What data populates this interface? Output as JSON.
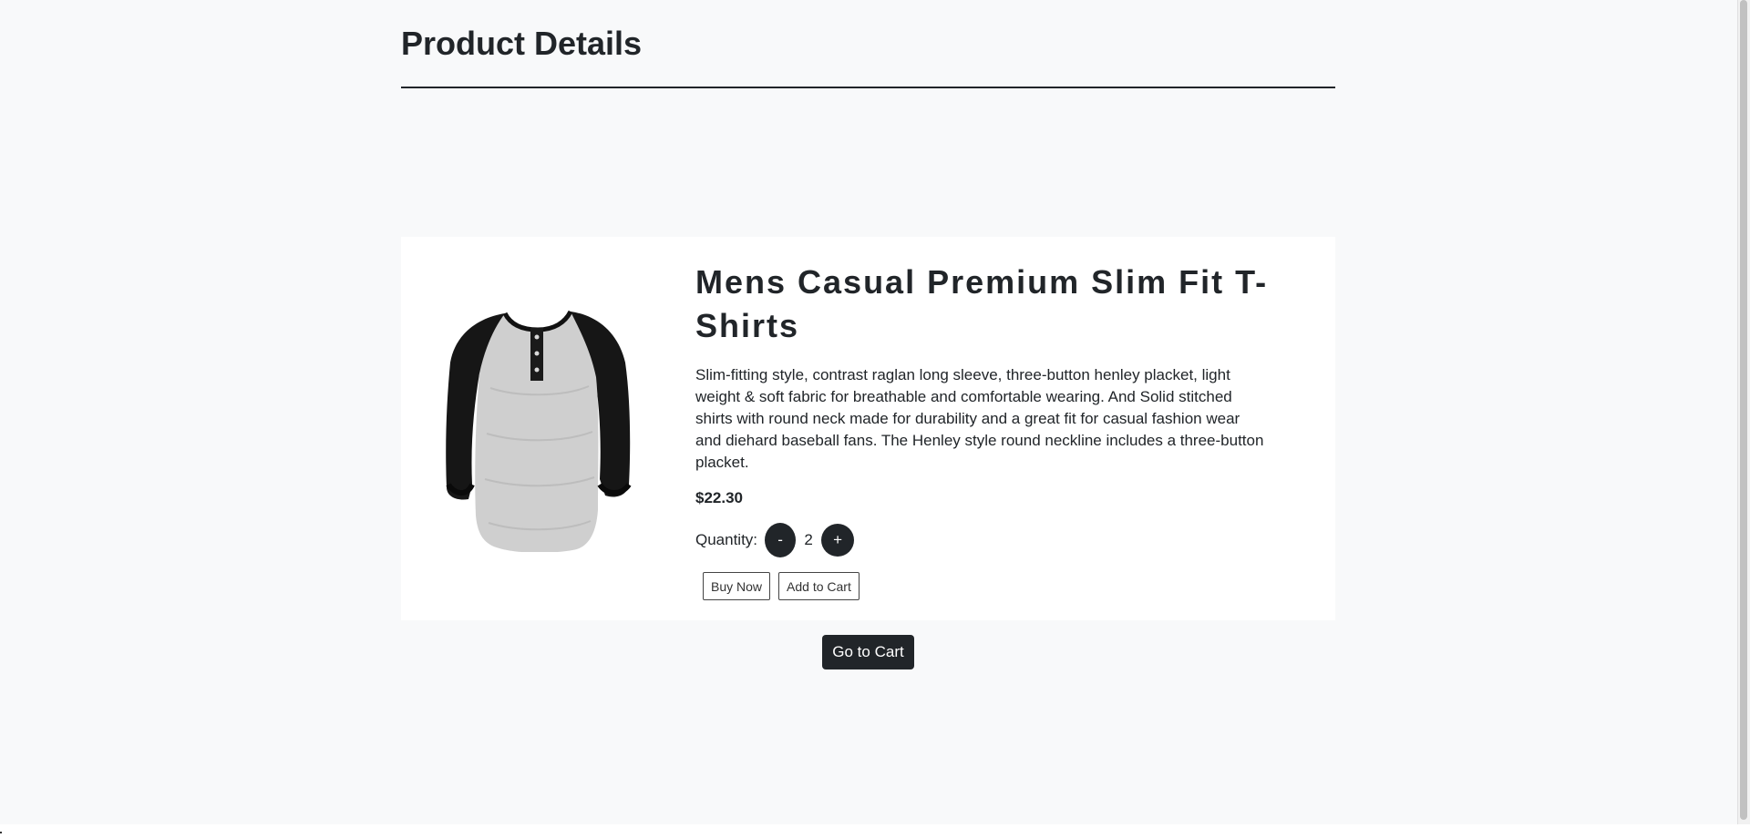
{
  "page": {
    "title": "Product Details"
  },
  "product": {
    "image_icon": "raglan-henley-tshirt-image",
    "title": "Mens Casual Premium Slim Fit T-Shirts",
    "description": "Slim-fitting style, contrast raglan long sleeve, three-button henley placket, light weight & soft fabric for breathable and comfortable wearing. And Solid stitched shirts with round neck made for durability and a great fit for casual fashion wear and diehard baseball fans. The Henley style round neckline includes a three-button placket.",
    "price": "$22.30"
  },
  "quantity": {
    "label": "Quantity:",
    "decrement_label": "-",
    "value": "2",
    "increment_label": "+"
  },
  "actions": {
    "buy_now_label": "Buy Now",
    "add_to_cart_label": "Add to Cart",
    "go_to_cart_label": "Go to Cart"
  },
  "colors": {
    "background": "#f8f9fa",
    "card": "#ffffff",
    "dark": "#212529"
  }
}
